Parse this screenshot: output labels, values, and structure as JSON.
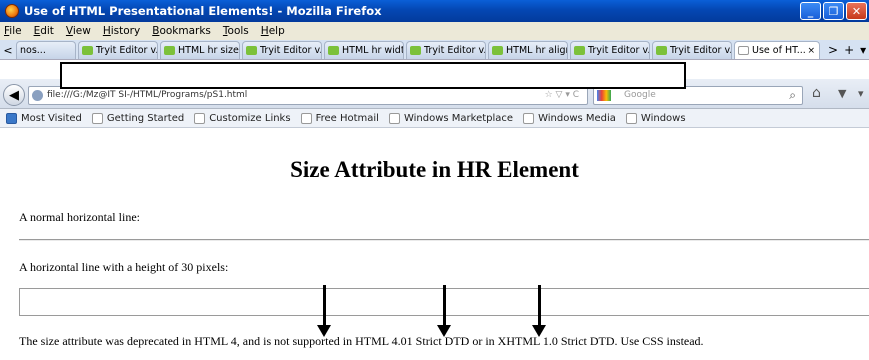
{
  "window": {
    "title": "Use of HTML Presentational Elements! - Mozilla Firefox",
    "minimize_label": "_",
    "maximize_label": "❐",
    "close_label": "✕"
  },
  "menu": [
    "File",
    "Edit",
    "View",
    "History",
    "Bookmarks",
    "Tools",
    "Help"
  ],
  "tabs": {
    "scroll_left": "<",
    "first": "nos...",
    "items": [
      "Tryit Editor v...",
      "HTML hr size...",
      "Tryit Editor v...",
      "HTML hr widt...",
      "Tryit Editor v...",
      "HTML hr align...",
      "Tryit Editor v...",
      "Tryit Editor v..."
    ],
    "active": "Use of HT...",
    "active_close": "×",
    "scroll_right": ">",
    "new_tab": "+",
    "list_all": "▾"
  },
  "navbar": {
    "back_icon": "back-arrow-icon",
    "back_glyph": "◀",
    "url": "file:///G:/Mz@IT SI-/HTML/Programs/pS1.html",
    "url_icons": "☆ ▽ ▾ C",
    "search_placeholder": "Google",
    "search_glyph": "⌕",
    "home_glyph": "⌂",
    "bookmark_glyph": "▼",
    "menu_glyph": "▾"
  },
  "bookmarks": [
    "Most Visited",
    "Getting Started",
    "Customize Links",
    "Free Hotmail",
    "Windows Marketplace",
    "Windows Media",
    "Windows"
  ],
  "page": {
    "heading": "Size Attribute in HR Element",
    "line1_label": "A normal horizontal line:",
    "line2_label": "A horizontal line with a height of 30 pixels:",
    "note": "The size attribute was deprecated in HTML 4, and is not supported in HTML 4.01 Strict DTD or in XHTML 1.0 Strict DTD. Use CSS instead."
  },
  "colors": {
    "titlebar": "#0447b3",
    "chrome": "#ece9d8",
    "arrow": "#000000"
  }
}
